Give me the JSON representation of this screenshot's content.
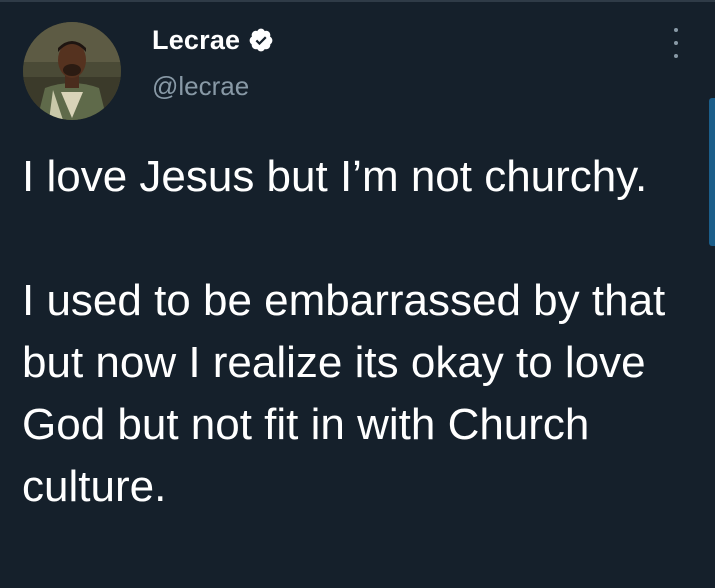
{
  "author": {
    "display_name": "Lecrae",
    "handle": "@lecrae",
    "verified": true
  },
  "tweet": {
    "paragraphs": [
      "I love Jesus but I’m not churchy.",
      "I used to be embarrassed by that but now I realize its okay to love God but not fit in with Church culture."
    ]
  },
  "colors": {
    "background": "#15202b",
    "text_primary": "#ffffff",
    "text_secondary": "#8899a6",
    "accent": "#1da1f2"
  },
  "icons": {
    "verified": "verified-badge-icon",
    "more": "more-vertical-icon"
  }
}
